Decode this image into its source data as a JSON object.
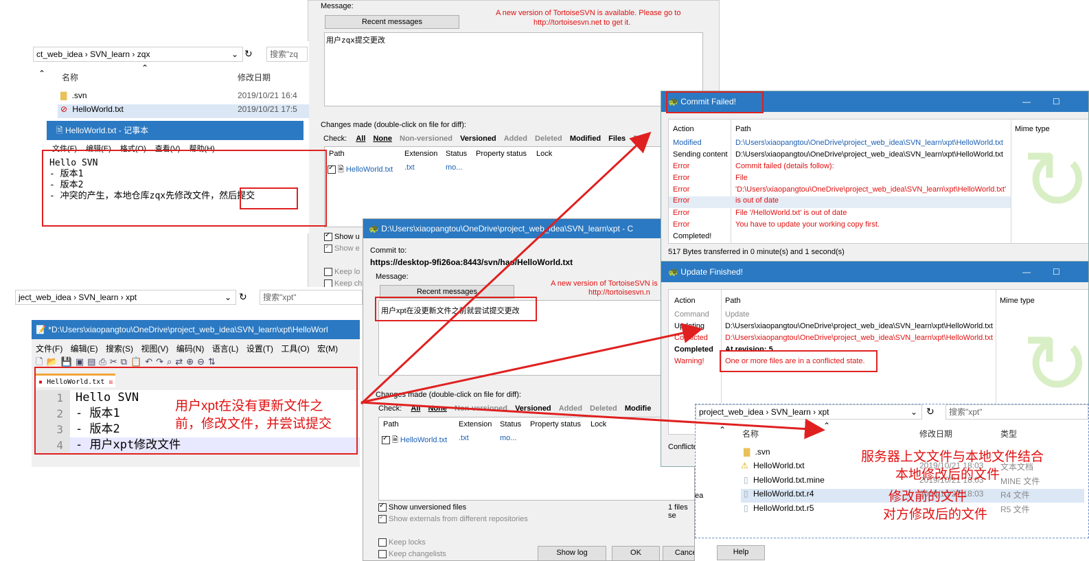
{
  "colors": {
    "accent": "#2b79c2",
    "annotation": "#e02020",
    "link": "#1a5fb4",
    "error": "#e01010"
  },
  "commit_top": {
    "message_label": "Message:",
    "recent_button": "Recent messages",
    "notice_line1": "A new version of TortoiseSVN is available. Please go to",
    "notice_line2": "http://tortoisesvn.net to get it.",
    "message_text": "用户zqx提交更改",
    "changes_label": "Changes made (double-click on file for diff):",
    "check_label": "Check:",
    "filters": [
      "All",
      "None",
      "Non-versioned",
      "Versioned",
      "Added",
      "Deleted",
      "Modified",
      "Files",
      "Di"
    ],
    "columns": [
      "Path",
      "Extension",
      "Status",
      "Property status",
      "Lock"
    ],
    "file": {
      "path": "HelloWorld.txt",
      "ext": ".txt",
      "status": "mo..."
    },
    "show_u": "Show u",
    "show_e": "Show e",
    "keep_lo": "Keep lo",
    "keep_ch": "Keep ch"
  },
  "explorer_zqx": {
    "path": [
      "ct_web_idea",
      "SVN_learn",
      "zqx"
    ],
    "search_placeholder": "搜索\"zq",
    "col_name": "名称",
    "col_date": "修改日期",
    "items": [
      {
        "name": ".svn",
        "date": "2019/10/21 16:4"
      },
      {
        "name": "HelloWorld.txt",
        "date": "2019/10/21 17:5"
      }
    ]
  },
  "notepad": {
    "title": "HelloWorld.txt - 记事本",
    "menus": [
      "文件(F)",
      "编辑(E)",
      "格式(O)",
      "查看(V)",
      "帮助(H)"
    ],
    "lines": [
      "Hello SVN",
      "- 版本1",
      "- 版本2",
      "- 冲突的产生，本地仓库zqx先修改文件，"
    ],
    "tail": "然后提交"
  },
  "explorer_xpt": {
    "path": [
      "ject_web_idea",
      "SVN_learn",
      "xpt"
    ],
    "search_placeholder": "搜索\"xpt\""
  },
  "notepadpp": {
    "title": "*D:\\Users\\xiaopangtou\\OneDrive\\project_web_idea\\SVN_learn\\xpt\\HelloWorl",
    "menus": [
      "文件(F)",
      "编辑(E)",
      "搜索(S)",
      "视图(V)",
      "编码(N)",
      "语言(L)",
      "设置(T)",
      "工具(O)",
      "宏(M)"
    ],
    "tab": "HelloWorld.txt",
    "line_numbers": [
      "1",
      "2",
      "3",
      "4"
    ],
    "lines": [
      "Hello SVN",
      "- 版本1",
      "- 版本2",
      "- 用户xpt修改文件"
    ]
  },
  "annotation_xpt": {
    "line1": "用户xpt在没有更新文件之",
    "line2": "前，修改文件，并尝试提交"
  },
  "commit_xpt": {
    "title": "D:\\Users\\xiaopangtou\\OneDrive\\project_web_idea\\SVN_learn\\xpt - C",
    "commit_to_label": "Commit to:",
    "url": "https://desktop-9fi26oa:8443/svn/hao/HelloWorld.txt",
    "message_label": "Message:",
    "recent_button": "Recent messages",
    "notice_line1": "A new version of TortoiseSVN is",
    "notice_line2": "http://tortoisesvn.n",
    "message_text": "用户xpt在没更新文件之前就尝试提交更改",
    "changes_label": "Changes made (double-click on file for diff):",
    "check_label": "Check:",
    "filters": [
      "All",
      "None",
      "Non-versioned",
      "Versioned",
      "Added",
      "Deleted",
      "Modifie"
    ],
    "columns": [
      "Path",
      "Extension",
      "Status",
      "Property status",
      "Lock"
    ],
    "file": {
      "path": "HelloWorld.txt",
      "ext": ".txt",
      "status": "mo..."
    },
    "show_unversioned": "Show unversioned files",
    "show_externals": "Show externals from different repositories",
    "files_selected": "1 files se",
    "keep_locks": "Keep locks",
    "keep_changelists": "Keep changelists",
    "buttons": [
      "Show log",
      "OK",
      "Cancel",
      "Help"
    ]
  },
  "commit_failed": {
    "title": "Commit Failed!",
    "col_action": "Action",
    "col_path": "Path",
    "col_mime": "Mime type",
    "rows": [
      {
        "action": "Modified",
        "path": "D:\\Users\\xiaopangtou\\OneDrive\\project_web_idea\\SVN_learn\\xpt\\HelloWorld.txt",
        "kind": "blue"
      },
      {
        "action": "Sending content",
        "path": "D:\\Users\\xiaopangtou\\OneDrive\\project_web_idea\\SVN_learn\\xpt\\HelloWorld.txt",
        "kind": "black"
      },
      {
        "action": "Error",
        "path": "Commit failed (details follow):",
        "kind": "red"
      },
      {
        "action": "Error",
        "path": "File",
        "kind": "red"
      },
      {
        "action": "Error",
        "path": "'D:\\Users\\xiaopangtou\\OneDrive\\project_web_idea\\SVN_learn\\xpt\\HelloWorld.txt'",
        "kind": "red"
      },
      {
        "action": "Error",
        "path": "is out of date",
        "kind": "red"
      },
      {
        "action": "Error",
        "path": "File '/HelloWorld.txt' is out of date",
        "kind": "red"
      },
      {
        "action": "Error",
        "path": "You have to update your working copy first.",
        "kind": "red"
      },
      {
        "action": "Completed!",
        "path": "",
        "kind": "black"
      }
    ],
    "status": "517 Bytes transferred in 0 minute(s) and 1 second(s)"
  },
  "update_finished": {
    "title": "Update Finished!",
    "col_action": "Action",
    "col_path": "Path",
    "col_mime": "Mime type",
    "rows": [
      {
        "action": "Command",
        "path": "Update",
        "kind": "gray"
      },
      {
        "action": "Updating",
        "path": "D:\\Users\\xiaopangtou\\OneDrive\\project_web_idea\\SVN_learn\\xpt\\HelloWorld.txt",
        "kind": "black"
      },
      {
        "action": "Conflicted",
        "path": "D:\\Users\\xiaopangtou\\OneDrive\\project_web_idea\\SVN_learn\\xpt\\HelloWorld.txt",
        "kind": "red"
      },
      {
        "action": "Completed",
        "path": "At revision: 5",
        "kind": "bold"
      },
      {
        "action": "Warning!",
        "path": "One or more files are in a conflicted state.",
        "kind": "red"
      }
    ],
    "conflicted_label": "Conflicted",
    "ea": "ea"
  },
  "explorer_result": {
    "path": [
      "project_web_idea",
      "SVN_learn",
      "xpt"
    ],
    "search_placeholder": "搜索\"xpt\"",
    "col_name": "名称",
    "col_date": "修改日期",
    "col_type": "类型",
    "items": [
      {
        "name": ".svn",
        "date": "",
        "type": ""
      },
      {
        "name": "HelloWorld.txt",
        "date": "2019/10/21 18:03",
        "type": "文本文档"
      },
      {
        "name": "HelloWorld.txt.mine",
        "date": "2019/10/21 18:03",
        "type": "MINE 文件"
      },
      {
        "name": "HelloWorld.txt.r4",
        "date": "2019/10/21 18:03",
        "type": "R4 文件"
      },
      {
        "name": "HelloWorld.txt.r5",
        "date": "",
        "type": "R5 文件"
      }
    ]
  },
  "annotation_files": {
    "line1": "服务器上文文件与本地文件结合",
    "line2": "本地修改后的文件",
    "line3": "修改前的文件",
    "line4": "对方修改后的文件"
  }
}
